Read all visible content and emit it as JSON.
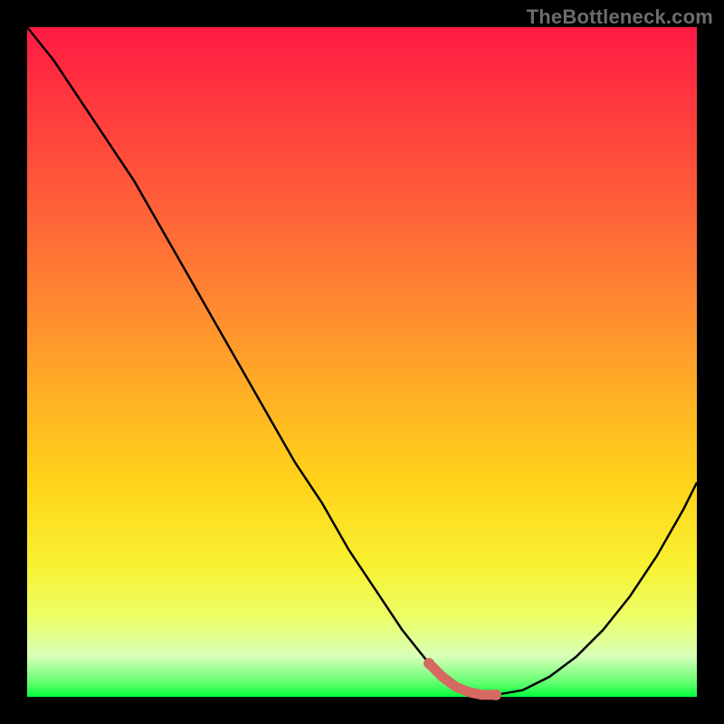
{
  "watermark": "TheBottleneck.com",
  "chart_data": {
    "type": "line",
    "title": "",
    "xlabel": "",
    "ylabel": "",
    "xlim": [
      0,
      100
    ],
    "ylim": [
      0,
      100
    ],
    "grid": false,
    "legend": false,
    "series": [
      {
        "name": "bottleneck-curve",
        "x": [
          0,
          4,
          8,
          12,
          16,
          20,
          24,
          28,
          32,
          36,
          40,
          44,
          48,
          52,
          56,
          60,
          62,
          64,
          66,
          68,
          70,
          74,
          78,
          82,
          86,
          90,
          94,
          98,
          100
        ],
        "y": [
          100,
          95,
          89,
          83,
          77,
          70,
          63,
          56,
          49,
          42,
          35,
          29,
          22,
          16,
          10,
          5,
          3,
          1.5,
          0.7,
          0.3,
          0.3,
          1,
          3,
          6,
          10,
          15,
          21,
          28,
          32
        ]
      }
    ],
    "highlight": {
      "name": "optimal-zone",
      "color": "#d66a63",
      "x": [
        60,
        62,
        64,
        66,
        68,
        70
      ],
      "y": [
        5,
        3,
        1.5,
        0.7,
        0.3,
        0.3
      ]
    }
  }
}
